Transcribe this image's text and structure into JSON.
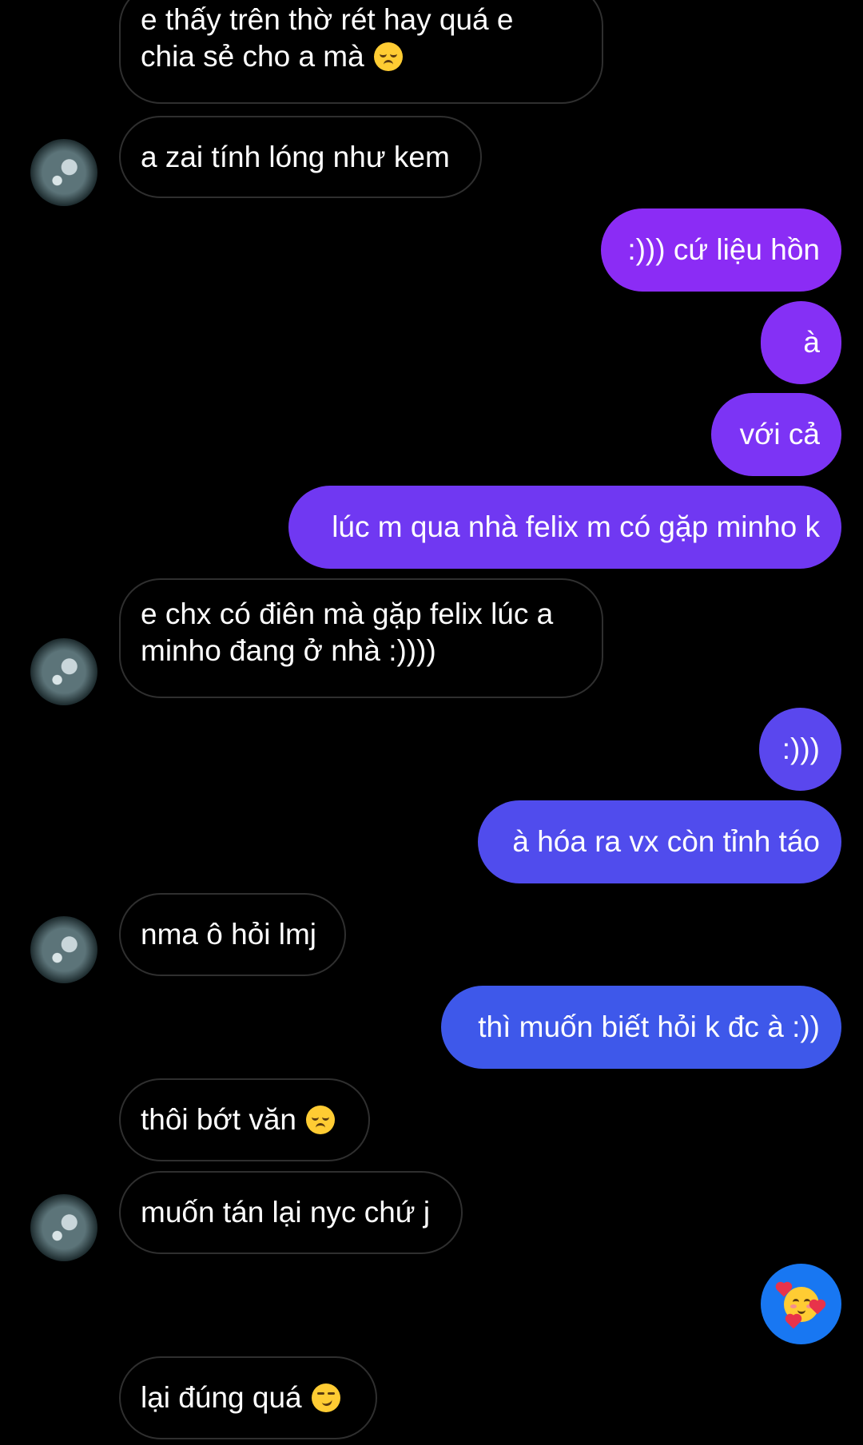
{
  "conversation": {
    "messages": [
      {
        "side": "in",
        "text_lines": [
          "e thấy trên thờ rét hay quá e",
          "chia sẻ cho a mà"
        ],
        "emoji": "disappointed-face"
      },
      {
        "side": "in",
        "text": "a zai tính lóng như kem"
      },
      {
        "side": "out",
        "text": ":))) cứ liệu hồn",
        "color": "#8b2cf5"
      },
      {
        "side": "out",
        "text": "à",
        "color": "#8530f5"
      },
      {
        "side": "out",
        "text": "với cả",
        "color": "#7c34f5"
      },
      {
        "side": "out",
        "text": "lúc m qua nhà felix m có gặp minho k",
        "color": "#7038f2"
      },
      {
        "side": "in",
        "text_lines": [
          "e chx có điên mà gặp felix lúc a",
          "minho đang ở nhà :))))"
        ]
      },
      {
        "side": "out",
        "text": ":)))",
        "color": "#5a47ee"
      },
      {
        "side": "out",
        "text": "à hóa ra vx còn tỉnh táo",
        "color": "#504ced"
      },
      {
        "side": "in",
        "text": "nma ô hỏi lmj"
      },
      {
        "side": "out",
        "text": "thì muốn biết hỏi k đc à :))",
        "color": "#3e58ea"
      },
      {
        "side": "in",
        "text": "thôi bớt văn",
        "emoji": "disappointed-face"
      },
      {
        "side": "in",
        "text": "muốn tán lại nyc chứ j"
      },
      {
        "side": "out",
        "emoji_only": "smiling-face-with-hearts",
        "color": "#1877f2"
      },
      {
        "side": "in",
        "text": "lại đúng quá",
        "emoji": "smirking-face"
      }
    ]
  },
  "colors": {
    "background": "#000000",
    "incoming_border": "#2f2f2f",
    "text": "#ffffff"
  }
}
